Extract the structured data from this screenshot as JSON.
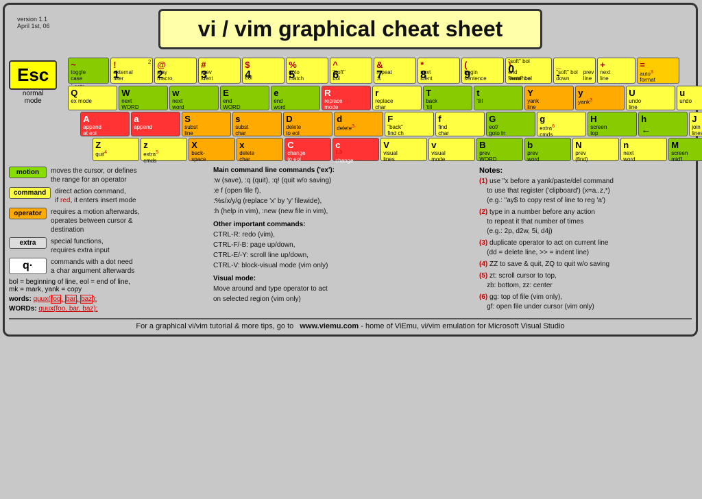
{
  "meta": {
    "version": "version 1.1",
    "date": "April 1st, 06"
  },
  "title": "vi / vim graphical cheat sheet",
  "esc": {
    "label": "Esc",
    "sub1": "normal",
    "sub2": "mode"
  },
  "num_row": [
    {
      "icon": "~",
      "label1": "toggle",
      "label2": "case",
      "sym": "` goto mark"
    },
    {
      "icon": "!",
      "label1": "external",
      "label2": "filter",
      "num": "1"
    },
    {
      "icon": "@",
      "label1": "play",
      "label2": "macro",
      "num": "2"
    },
    {
      "icon": "#",
      "label1": "prev",
      "label2": "ident",
      "num": "3"
    },
    {
      "icon": "$",
      "label1": "eol",
      "num": "4"
    },
    {
      "icon": "%",
      "label1": "goto",
      "label2": "match",
      "num": "5"
    },
    {
      "icon": "^",
      "label1": "\"soft\"",
      "label2": "bol",
      "num": "6"
    },
    {
      "icon": "&",
      "label1": "repeat",
      "label2": ":s",
      "num": "7"
    },
    {
      "icon": "*",
      "label1": "next",
      "label2": "ident",
      "num": "8"
    },
    {
      "icon": "(",
      "label1": "begin",
      "label2": "sentence",
      "num": "9"
    },
    {
      "icon": ")",
      "label1": "end",
      "label2": "sentence",
      "num": "0"
    },
    {
      "icon": "_",
      "label1": "\"soft\" bol",
      "label2": "down",
      "num": ""
    },
    {
      "icon": "+",
      "label1": "next",
      "label2": "line"
    },
    {
      "icon": "=",
      "label1": "auto³",
      "label2": "format",
      "special": true
    }
  ],
  "footer": {
    "text": "For a graphical vi/vim tutorial & more tips, go to",
    "url": "www.viemu.com",
    "suffix": " - home of ViEmu, vi/vim emulation for Microsoft Visual Studio"
  },
  "legend": [
    {
      "badge": "motion",
      "color": "green",
      "text": "moves the cursor, or defines\nthe range for an operator"
    },
    {
      "badge": "command",
      "color": "yellow",
      "text": "direct action command,\nif red, it enters insert mode"
    },
    {
      "badge": "operator",
      "color": "orange",
      "text": "requires a motion afterwards,\noperates between cursor &\ndestination"
    },
    {
      "badge": "extra",
      "color": "gray",
      "text": "special functions,\nrequires extra input"
    },
    {
      "badge": "q·",
      "color": "white",
      "text": "commands with a dot need\na char argument afterwards"
    }
  ],
  "bottom_legend": {
    "bol_text": "bol = beginning of line, eol = end of line,",
    "mk_text": "mk = mark, yank = copy",
    "words_label": "words:",
    "words_example": "quux(foo, bar, baz);",
    "WORDS_label": "WORDs:",
    "WORDS_example": "quux(foo, bar, baz);"
  },
  "main_commands": {
    "title": "Main command line commands ('ex'):",
    "items": [
      ":w (save), :q (quit), :q! (quit w/o saving)",
      ":e f (open file f),",
      ":%s/x/y/g (replace 'x' by 'y' filewide),",
      ":h (help in vim), :new (new file in vim),"
    ],
    "other_title": "Other important commands:",
    "other_items": [
      "CTRL-R: redo (vim),",
      "CTRL-F/-B: page up/down,",
      "CTRL-E/-Y: scroll line up/down,",
      "CTRL-V: block-visual mode (vim only)"
    ],
    "visual_title": "Visual mode:",
    "visual_text": "Move around and type operator to act\non selected region (vim only)"
  },
  "notes": {
    "title": "Notes:",
    "items": [
      {
        "num": "(1)",
        "text": "use \"x before a yank/paste/del command\n to use that register ('clipboard') (x=a..z,*)\n (e.g.: \"ay$ to copy rest of line to reg 'a')"
      },
      {
        "num": "(2)",
        "text": "type in a number before any action\n to repeat it that number of times\n (e.g.: 2p, d2w, 5i, d4j)"
      },
      {
        "num": "(3)",
        "text": "duplicate operator to act on current line\n (dd = delete line, >> = indent line)"
      },
      {
        "num": "(4)",
        "text": "ZZ to save & quit, ZQ to quit w/o saving"
      },
      {
        "num": "(5)",
        "text": "zt: scroll cursor to top,\n zb: bottom, zz: center"
      },
      {
        "num": "(6)",
        "text": "gg: top of file (vim only),\n gf: open file under cursor (vim only)"
      }
    ]
  }
}
